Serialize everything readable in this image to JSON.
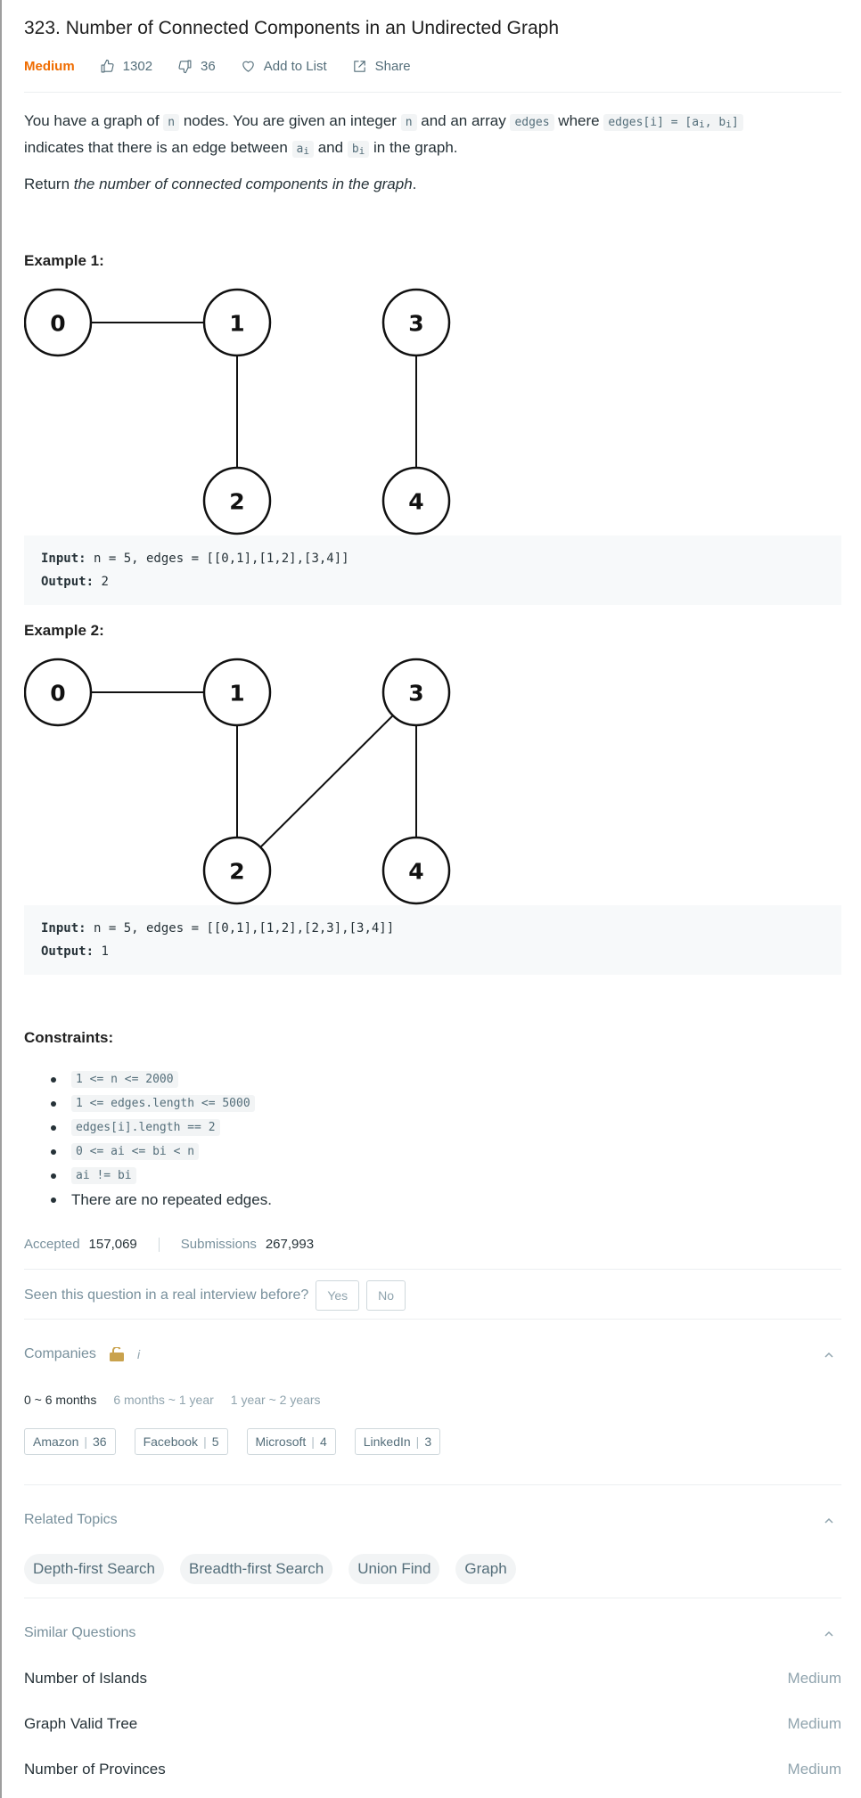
{
  "problem": {
    "title": "323. Number of Connected Components in an Undirected Graph",
    "difficulty": "Medium",
    "likes": "1302",
    "dislikes": "36",
    "add_to_list": "Add to List",
    "share": "Share"
  },
  "description": {
    "p1_a": "You have a graph of ",
    "p1_code_n1": "n",
    "p1_b": " nodes. You are given an integer ",
    "p1_code_n2": "n",
    "p1_c": " and an array ",
    "p1_code_edges": "edges",
    "p1_d": " where ",
    "p1_code_edge_pre": "edges[i] = [a",
    "p1_code_edge_sub_a": "i",
    "p1_code_edge_mid": ", b",
    "p1_code_edge_sub_b": "i",
    "p1_code_edge_post": "]",
    "p1_e": "indicates that there is an edge between ",
    "p1_code_a": "a",
    "p1_code_a_sub": "i",
    "p1_f": " and ",
    "p1_code_b": "b",
    "p1_code_b_sub": "i",
    "p1_g": " in the graph.",
    "p2_a": "Return ",
    "p2_em": "the number of connected components in the graph",
    "p2_b": "."
  },
  "examples": [
    {
      "heading": "Example 1:",
      "nodes": [
        "0",
        "1",
        "2",
        "3",
        "4"
      ],
      "edges": [
        [
          0,
          1
        ],
        [
          1,
          2
        ],
        [
          3,
          4
        ]
      ],
      "input_label": "Input:",
      "input_value": " n = 5, edges = [[0,1],[1,2],[3,4]]",
      "output_label": "Output:",
      "output_value": " 2"
    },
    {
      "heading": "Example 2:",
      "nodes": [
        "0",
        "1",
        "2",
        "3",
        "4"
      ],
      "edges": [
        [
          0,
          1
        ],
        [
          1,
          2
        ],
        [
          2,
          3
        ],
        [
          3,
          4
        ]
      ],
      "input_label": "Input:",
      "input_value": " n = 5, edges = [[0,1],[1,2],[2,3],[3,4]]",
      "output_label": "Output:",
      "output_value": " 1"
    }
  ],
  "constraints": {
    "heading": "Constraints:",
    "items": [
      "1 <= n <= 2000",
      "1 <= edges.length <= 5000",
      "edges[i].length == 2",
      "0 <= ai <= bi < n",
      "ai != bi",
      "There are no repeated edges."
    ]
  },
  "stats": {
    "accepted_label": "Accepted",
    "accepted_value": "157,069",
    "submissions_label": "Submissions",
    "submissions_value": "267,993"
  },
  "interview": {
    "question": "Seen this question in a real interview before?",
    "yes": "Yes",
    "no": "No"
  },
  "companies": {
    "title": "Companies",
    "info": "i",
    "ranges": [
      "0 ~ 6 months",
      "6 months ~ 1 year",
      "1 year ~ 2 years"
    ],
    "tags": [
      {
        "name": "Amazon",
        "count": "36"
      },
      {
        "name": "Facebook",
        "count": "5"
      },
      {
        "name": "Microsoft",
        "count": "4"
      },
      {
        "name": "LinkedIn",
        "count": "3"
      }
    ]
  },
  "related_topics": {
    "title": "Related Topics",
    "tags": [
      "Depth-first Search",
      "Breadth-first Search",
      "Union Find",
      "Graph"
    ]
  },
  "similar_questions": {
    "title": "Similar Questions",
    "items": [
      {
        "name": "Number of Islands",
        "level": "Medium"
      },
      {
        "name": "Graph Valid Tree",
        "level": "Medium"
      },
      {
        "name": "Number of Provinces",
        "level": "Medium"
      }
    ]
  },
  "colors": {
    "difficulty_medium": "#ef6c00",
    "muted": "#78909c",
    "text": "#263238"
  }
}
